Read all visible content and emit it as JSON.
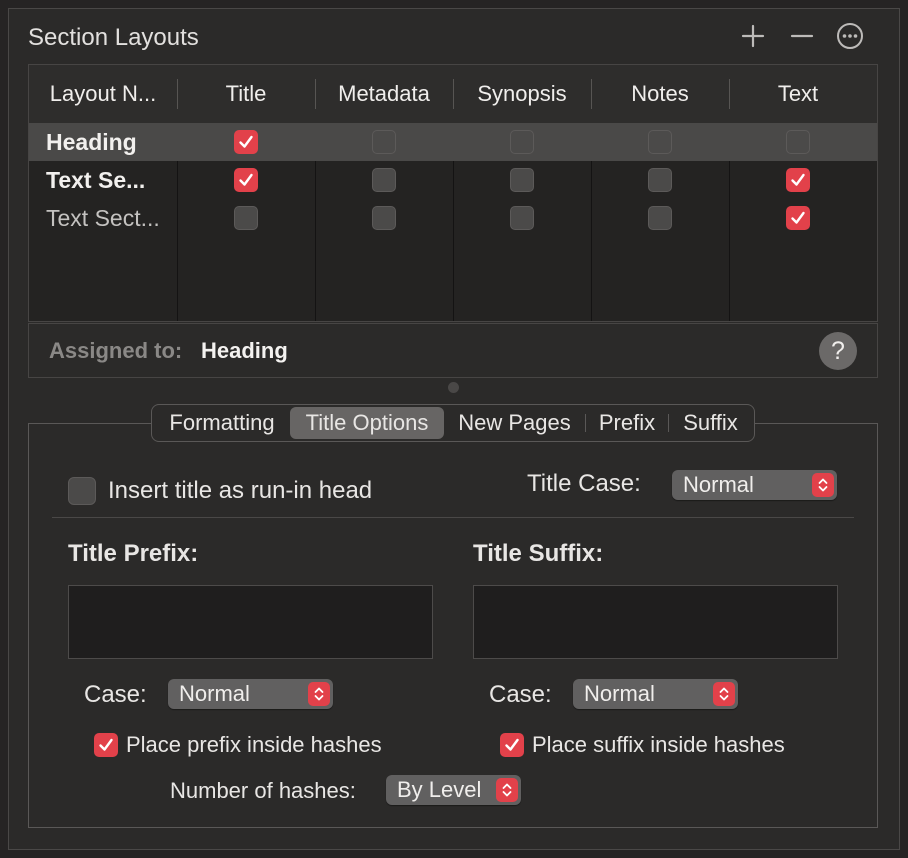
{
  "window": {
    "title": "Section Layouts"
  },
  "toolbar": {
    "add": "add",
    "remove": "remove",
    "more": "more"
  },
  "table": {
    "columns": [
      "Layout N...",
      "Title",
      "Metadata",
      "Synopsis",
      "Notes",
      "Text"
    ],
    "rows": [
      {
        "name": "Heading",
        "bold": true,
        "selected": true,
        "checks": [
          true,
          false,
          false,
          false,
          false
        ]
      },
      {
        "name": "Text Se...",
        "bold": true,
        "selected": false,
        "checks": [
          true,
          false,
          false,
          false,
          true
        ]
      },
      {
        "name": "Text Sect...",
        "bold": false,
        "selected": false,
        "checks": [
          false,
          false,
          false,
          false,
          true
        ]
      }
    ]
  },
  "assigned": {
    "label": "Assigned to:",
    "value": "Heading",
    "help": "?"
  },
  "tabs": [
    {
      "label": "Formatting",
      "active": false
    },
    {
      "label": "Title Options",
      "active": true
    },
    {
      "label": "New Pages",
      "active": false
    },
    {
      "label": "Prefix",
      "active": false
    },
    {
      "label": "Suffix",
      "active": false
    }
  ],
  "options": {
    "run_in_label": "Insert title as run-in head",
    "title_case_label": "Title Case:",
    "title_case_value": "Normal",
    "prefix_label": "Title Prefix:",
    "suffix_label": "Title Suffix:",
    "prefix_case_label": "Case:",
    "prefix_case_value": "Normal",
    "suffix_case_label": "Case:",
    "suffix_case_value": "Normal",
    "prefix_hash_label": "Place prefix inside hashes",
    "suffix_hash_label": "Place suffix inside hashes",
    "hashes_label": "Number of hashes:",
    "hashes_value": "By Level"
  },
  "colors": {
    "accent": "#e2414a",
    "background": "#2b2a29"
  }
}
